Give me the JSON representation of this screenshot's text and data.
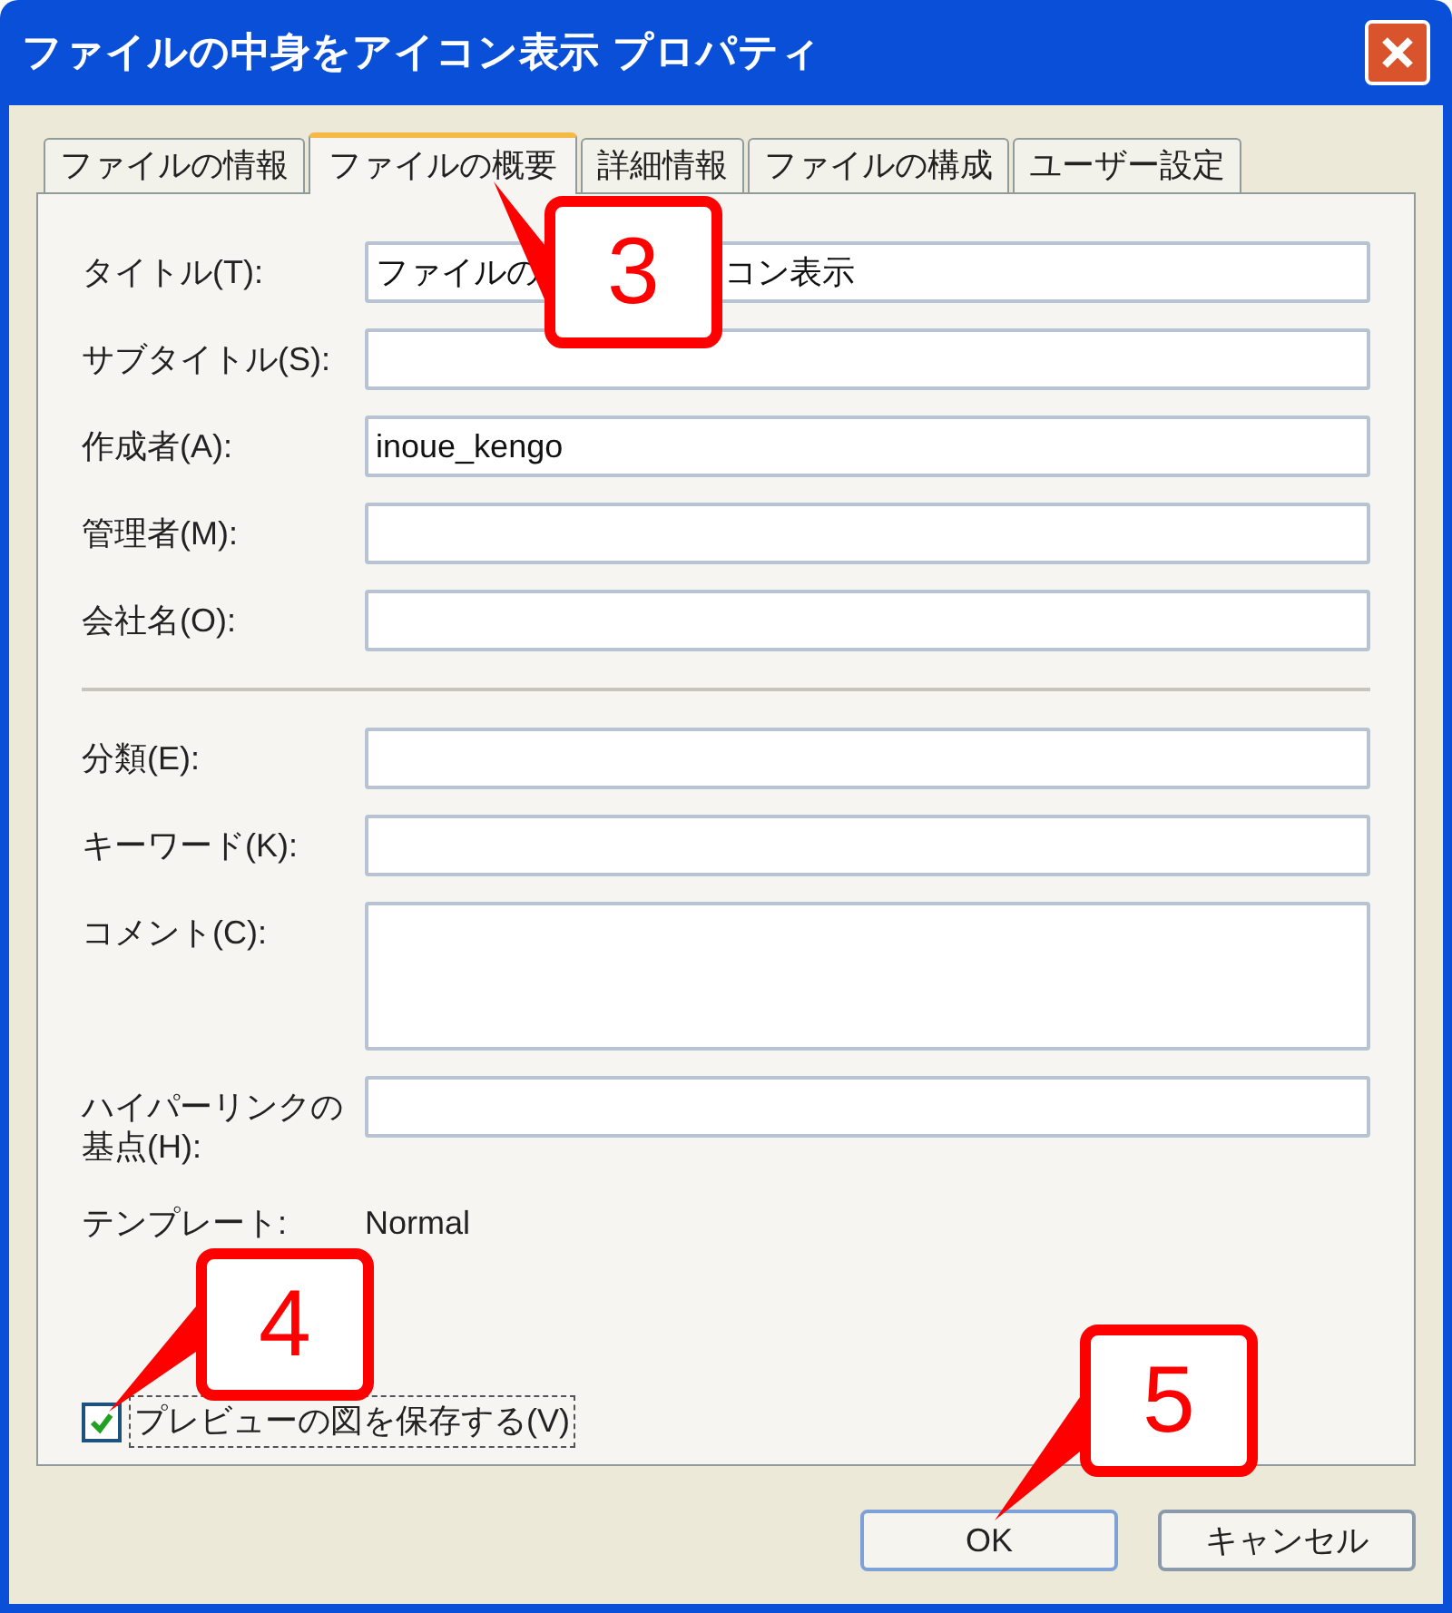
{
  "window": {
    "title": "ファイルの中身をアイコン表示 プロパティ"
  },
  "tabs": [
    {
      "label": "ファイルの情報",
      "selected": false
    },
    {
      "label": "ファイルの概要",
      "selected": true
    },
    {
      "label": "詳細情報",
      "selected": false
    },
    {
      "label": "ファイルの構成",
      "selected": false
    },
    {
      "label": "ユーザー設定",
      "selected": false
    }
  ],
  "fields_top": [
    {
      "label": "タイトル(T):",
      "kind": "split",
      "value_parts": [
        "ファイルの",
        "コン表示"
      ]
    },
    {
      "label": "サブタイトル(S):",
      "kind": "text"
    },
    {
      "label": "作成者(A):",
      "kind": "text",
      "value": "inoue_kengo"
    },
    {
      "label": "管理者(M):",
      "kind": "text"
    },
    {
      "label": "会社名(O):",
      "kind": "text"
    }
  ],
  "fields_bottom": [
    {
      "label": "分類(E):",
      "kind": "text"
    },
    {
      "label": "キーワード(K):",
      "kind": "text"
    },
    {
      "label": "コメント(C):",
      "kind": "multiline"
    },
    {
      "label": "ハイパーリンクの基点(H):",
      "kind": "text"
    },
    {
      "label": "テンプレート:",
      "kind": "static",
      "value": "Normal"
    }
  ],
  "preview_checkbox": {
    "label": "プレビューの図を保存する(V)",
    "checked": true
  },
  "buttons": [
    "OK",
    "キャンセル"
  ],
  "callouts": [
    {
      "number": "3"
    },
    {
      "number": "4"
    },
    {
      "number": "5"
    }
  ]
}
